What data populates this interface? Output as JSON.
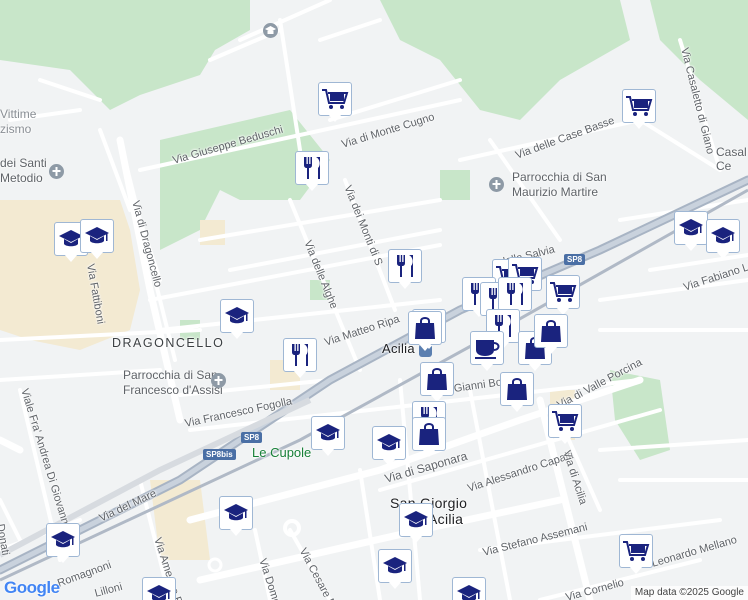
{
  "map": {
    "attribution": "Map data ©2025 Google",
    "logo": "Google",
    "areas": [
      {
        "id": "dragoncello",
        "text": "DRAGONCELLO"
      },
      {
        "id": "acilia",
        "text": "Acilia"
      },
      {
        "id": "san-giorgio",
        "text": "San Giorgio"
      },
      {
        "id": "acilia-2",
        "text": "Acilia"
      },
      {
        "id": "le-cupole",
        "text": "Le Cupole"
      }
    ],
    "pois": [
      {
        "id": "santi-metodio-1",
        "text": "dei Santi"
      },
      {
        "id": "santi-metodio-2",
        "text": "Metodio"
      },
      {
        "id": "vittime-1",
        "text": "Vittime"
      },
      {
        "id": "vittime-2",
        "text": "zismo"
      },
      {
        "id": "parrocchia-maurizio-1",
        "text": "Parrocchia di San"
      },
      {
        "id": "parrocchia-maurizio-2",
        "text": "Maurizio Martire"
      },
      {
        "id": "parrocchia-francesco-1",
        "text": "Parrocchia di San"
      },
      {
        "id": "parrocchia-francesco-2",
        "text": "Francesco d'Assisi"
      },
      {
        "id": "casale-1",
        "text": "Casal"
      },
      {
        "id": "casale-2",
        "text": "Ce"
      }
    ],
    "streets": [
      {
        "id": "beduschi",
        "text": "Via Giuseppe Beduschi"
      },
      {
        "id": "monte-cugno",
        "text": "Via di Monte Cugno"
      },
      {
        "id": "monti-san",
        "text": "Via dei Monti di S"
      },
      {
        "id": "alghe",
        "text": "Via delle Alghe"
      },
      {
        "id": "dragoncello-st",
        "text": "Via di Dragoncello"
      },
      {
        "id": "fattiboni",
        "text": "Via Fattiboni"
      },
      {
        "id": "matteo-ripa",
        "text": "Via Matteo Ripa"
      },
      {
        "id": "fogolla",
        "text": "Via Francesco Fogolla"
      },
      {
        "id": "mare",
        "text": "Via del Mare"
      },
      {
        "id": "romagnoni",
        "text": "Romagnoni"
      },
      {
        "id": "lilloni",
        "text": "Lilloni"
      },
      {
        "id": "andrea",
        "text": "Viale Fra' Andrea Di Giovanni"
      },
      {
        "id": "donati",
        "text": "Donati"
      },
      {
        "id": "amedeo",
        "text": "Via Amedeo Rec"
      },
      {
        "id": "domen",
        "text": "Via Domen"
      },
      {
        "id": "cesare",
        "text": "Via Cesare M"
      },
      {
        "id": "saponara",
        "text": "Via di Saponara"
      },
      {
        "id": "capalti",
        "text": "Via Alessandro Capalti"
      },
      {
        "id": "valle-porcina",
        "text": "Via di Valle Porcina"
      },
      {
        "id": "acilia-st",
        "text": "Via di Acilia"
      },
      {
        "id": "assemani",
        "text": "Via Stefano Assemani"
      },
      {
        "id": "mellano",
        "text": "Leonardo Mellano"
      },
      {
        "id": "cornelio",
        "text": "Via Cornelio"
      },
      {
        "id": "gianni-bold",
        "text": "Gianni Bold"
      },
      {
        "id": "salvia",
        "text": "della Salvia"
      },
      {
        "id": "case-basse",
        "text": "Via delle Case Basse"
      },
      {
        "id": "casaletto",
        "text": "Via Casaletto di Giano"
      },
      {
        "id": "fabiano",
        "text": "Via Fabiano La"
      }
    ],
    "road_shields": [
      {
        "id": "sp8-a",
        "text": "SP8"
      },
      {
        "id": "sp8-b",
        "text": "SP8"
      },
      {
        "id": "sp8bis",
        "text": "SP8bis"
      }
    ],
    "markers": [
      {
        "type": "school",
        "icon": "graduation-cap-icon"
      },
      {
        "type": "shopping-cart",
        "icon": "shopping-cart-icon"
      },
      {
        "type": "shopping-cart",
        "icon": "shopping-cart-icon"
      },
      {
        "type": "restaurant",
        "icon": "fork-knife-icon"
      },
      {
        "type": "restaurant",
        "icon": "fork-knife-icon"
      },
      {
        "type": "school",
        "icon": "graduation-cap-icon"
      },
      {
        "type": "school",
        "icon": "graduation-cap-icon"
      },
      {
        "type": "school",
        "icon": "graduation-cap-icon"
      },
      {
        "type": "restaurant",
        "icon": "fork-knife-icon"
      },
      {
        "type": "shopping-cart",
        "icon": "shopping-cart-icon"
      },
      {
        "type": "shopping-cart",
        "icon": "shopping-cart-icon"
      },
      {
        "type": "restaurant",
        "icon": "fork-knife-icon"
      },
      {
        "type": "restaurant",
        "icon": "fork-knife-icon"
      },
      {
        "type": "restaurant",
        "icon": "fork-knife-icon"
      },
      {
        "type": "shopping-cart",
        "icon": "shopping-cart-icon"
      },
      {
        "type": "restaurant",
        "icon": "fork-knife-icon"
      },
      {
        "type": "shopping-bag",
        "icon": "shopping-bag-icon"
      },
      {
        "type": "restaurant",
        "icon": "fork-knife-icon"
      },
      {
        "type": "coffee",
        "icon": "coffee-cup-icon"
      },
      {
        "type": "shopping-bag",
        "icon": "shopping-bag-icon"
      },
      {
        "type": "shopping-bag",
        "icon": "shopping-bag-icon"
      },
      {
        "type": "shopping-bag",
        "icon": "shopping-bag-icon"
      },
      {
        "type": "shopping-bag",
        "icon": "shopping-bag-icon"
      },
      {
        "type": "restaurant",
        "icon": "fork-knife-icon"
      },
      {
        "type": "shopping-bag",
        "icon": "shopping-bag-icon"
      },
      {
        "type": "shopping-cart",
        "icon": "shopping-cart-icon"
      },
      {
        "type": "school",
        "icon": "graduation-cap-icon"
      },
      {
        "type": "school",
        "icon": "graduation-cap-icon"
      },
      {
        "type": "school",
        "icon": "graduation-cap-icon"
      },
      {
        "type": "school",
        "icon": "graduation-cap-icon"
      },
      {
        "type": "school",
        "icon": "graduation-cap-icon"
      },
      {
        "type": "school",
        "icon": "graduation-cap-icon"
      },
      {
        "type": "shopping-cart",
        "icon": "shopping-cart-icon"
      },
      {
        "type": "school",
        "icon": "graduation-cap-icon"
      },
      {
        "type": "school",
        "icon": "graduation-cap-icon"
      },
      {
        "type": "school",
        "icon": "graduation-cap-icon"
      }
    ],
    "colors": {
      "background": "#f1f3f4",
      "park": "#c8e6c9",
      "road": "#ffffff",
      "highway": "#a8b4c4",
      "marker_icon": "#1a237e",
      "marker_border": "#9fb7d4"
    }
  }
}
